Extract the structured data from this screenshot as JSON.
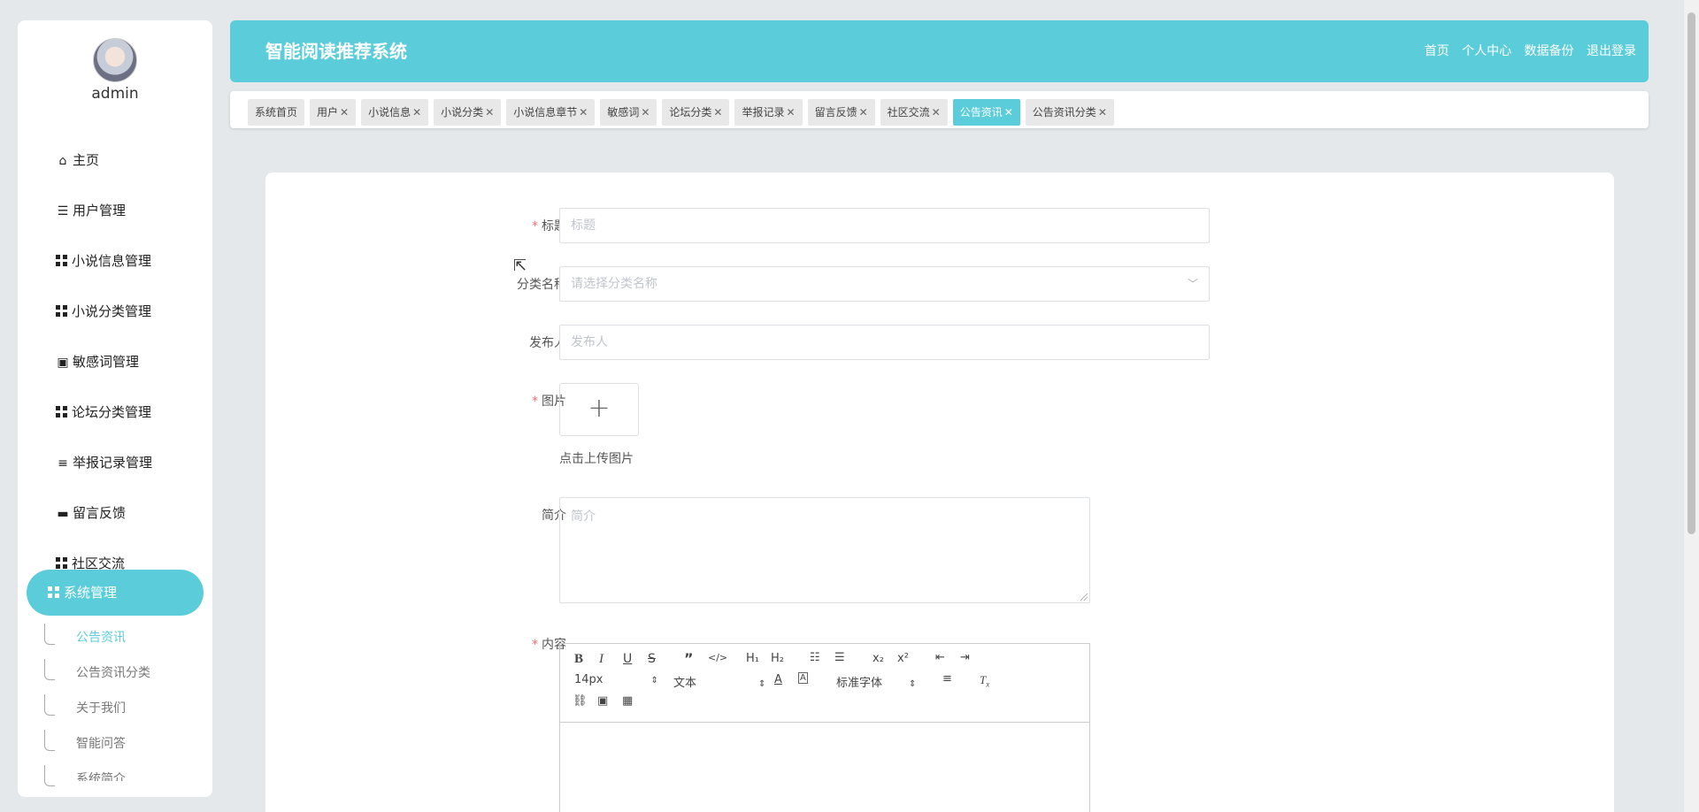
{
  "sidebar": {
    "username": "admin",
    "menu": [
      {
        "label": "主页",
        "icon": "home-icon"
      },
      {
        "label": "用户管理",
        "icon": "list-icon"
      },
      {
        "label": "小说信息管理",
        "icon": "grid-icon"
      },
      {
        "label": "小说分类管理",
        "icon": "grid-icon"
      },
      {
        "label": "敏感词管理",
        "icon": "comment-icon"
      },
      {
        "label": "论坛分类管理",
        "icon": "grid-icon"
      },
      {
        "label": "举报记录管理",
        "icon": "sliders-icon"
      },
      {
        "label": "留言反馈",
        "icon": "monitor-icon"
      },
      {
        "label": "社区交流",
        "icon": "grid-icon"
      },
      {
        "label": "系统管理",
        "icon": "grid-icon"
      }
    ],
    "submenu": [
      "公告资讯",
      "公告资讯分类",
      "关于我们",
      "智能问答",
      "系统简介"
    ]
  },
  "header": {
    "title": "智能阅读推荐系统",
    "links": [
      "首页",
      "个人中心",
      "数据备份",
      "退出登录"
    ]
  },
  "tabs": [
    {
      "label": "系统首页",
      "closable": false
    },
    {
      "label": "用户",
      "closable": true
    },
    {
      "label": "小说信息",
      "closable": true
    },
    {
      "label": "小说分类",
      "closable": true
    },
    {
      "label": "小说信息章节",
      "closable": true
    },
    {
      "label": "敏感词",
      "closable": true
    },
    {
      "label": "论坛分类",
      "closable": true
    },
    {
      "label": "举报记录",
      "closable": true
    },
    {
      "label": "留言反馈",
      "closable": true
    },
    {
      "label": "社区交流",
      "closable": true
    },
    {
      "label": "公告资讯",
      "closable": true,
      "active": true
    },
    {
      "label": "公告资讯分类",
      "closable": true
    }
  ],
  "form": {
    "title_label": "标题",
    "title_placeholder": "标题",
    "category_label": "分类名称",
    "category_placeholder": "请选择分类名称",
    "publisher_label": "发布人",
    "publisher_placeholder": "发布人",
    "image_label": "图片",
    "upload_plus": "+",
    "upload_hint": "点击上传图片",
    "intro_label": "简介",
    "intro_placeholder": "简介",
    "content_label": "内容",
    "required_mark": "*"
  },
  "editor": {
    "font_size": "14px",
    "block_type": "文本",
    "font_family": "标准字体"
  },
  "colors": {
    "accent": "#5bcdda",
    "required": "#f56c6c",
    "background": "#e4e8ea"
  }
}
